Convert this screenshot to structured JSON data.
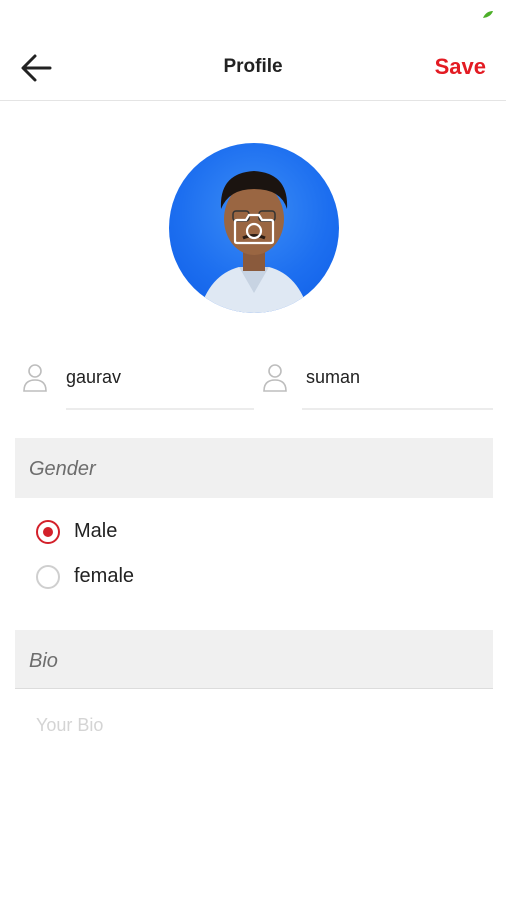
{
  "header": {
    "title": "Profile",
    "save_label": "Save",
    "accent_color": "#e31b23"
  },
  "profile": {
    "first_name": "gaurav",
    "last_name": "suman"
  },
  "gender": {
    "header": "Gender",
    "options": [
      {
        "label": "Male",
        "selected": true
      },
      {
        "label": "female",
        "selected": false
      }
    ]
  },
  "bio": {
    "header": "Bio",
    "placeholder": "Your Bio",
    "value": ""
  },
  "icons": {
    "back": "arrow-left-icon",
    "camera": "camera-icon",
    "person": "person-icon"
  }
}
